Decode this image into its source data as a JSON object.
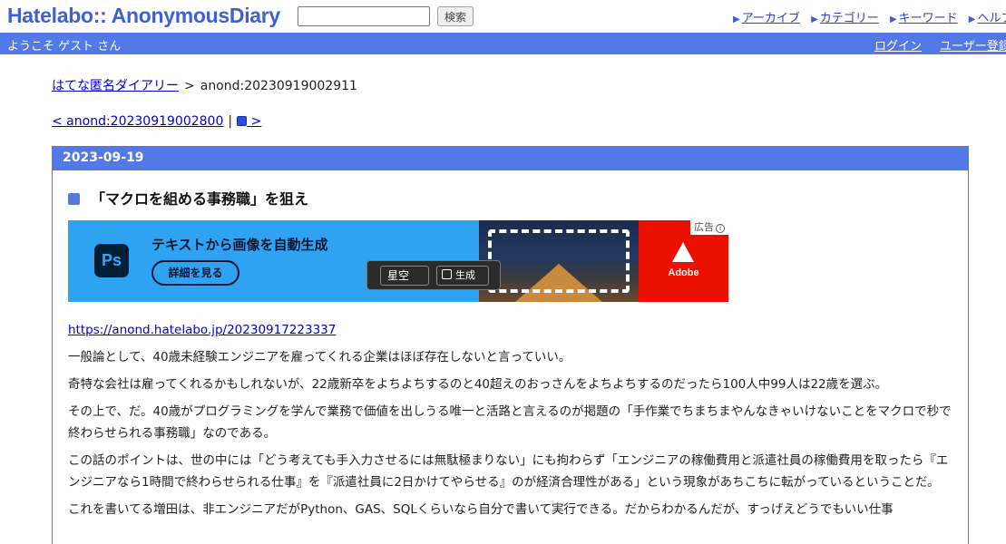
{
  "header": {
    "logo": "Hatelabo:: AnonymousDiary",
    "search_placeholder": "",
    "search_button": "検索",
    "nav": [
      "アーカイブ",
      "カテゴリー",
      "キーワード",
      "ヘルプ"
    ]
  },
  "welcome_bar": {
    "greeting": "ようこそ ゲスト さん",
    "login": "ログイン",
    "register": "ユーザー登録"
  },
  "breadcrumb": {
    "home": "はてな匿名ダイアリー",
    "separator": ">",
    "current": "anond:20230919002911"
  },
  "pager": {
    "prev": "< anond:20230919002800",
    "separator": "|",
    "next": ">"
  },
  "day": {
    "date": "2023-09-19",
    "entry": {
      "title": "「マクロを組める事務職」を狙え",
      "ad": {
        "product_icon": "Ps",
        "headline": "テキストから画像を自動生成",
        "cta": "詳細を見る",
        "prompt_field": "星空",
        "generate": "生成",
        "brand": "Adobe",
        "label": "広告"
      },
      "link": "https://anond.hatelabo.jp/20230917223337",
      "paragraphs": [
        "一般論として、40歳未経験エンジニアを雇ってくれる企業はほぼ存在しないと言っていい。",
        "奇特な会社は雇ってくれるかもしれないが、22歳新卒をよちよちするのと40超えのおっさんをよちよちするのだったら100人中99人は22歳を選ぶ。",
        "その上で、だ。40歳がプログラミングを学んで業務で価値を出しうる唯一と活路と言えるのが掲題の「手作業でちまちまやんなきゃいけないことをマクロで秒で終わらせられる事務職」なのである。",
        "この話のポイントは、世の中には「どう考えても手入力させるには無駄極まりない」にも拘わらず「エンジニアの稼働費用と派遣社員の稼働費用を取ったら『エンジニアなら1時間で終わらせられる仕事』を『派遣社員に2日かけてやらせる』のが経済合理性がある」という現象があちこちに転がっているということだ。",
        "これを書いてる増田は、非エンジニアだがPython、GAS、SQLくらいなら自分で書いて実行できる。だからわかるんだが、すっげえどうでもいい仕事"
      ]
    }
  },
  "colors": {
    "brand_blue": "#5279e7",
    "link": "#0000cc"
  }
}
